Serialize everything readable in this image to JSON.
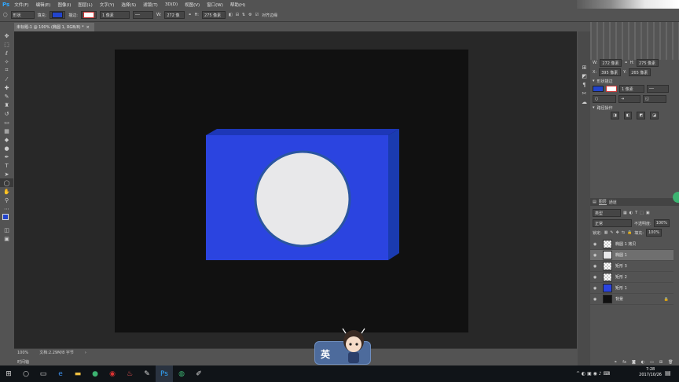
{
  "app": {
    "logo": "Ps"
  },
  "menu": [
    "文件(F)",
    "编辑(E)",
    "图像(I)",
    "图层(L)",
    "文字(Y)",
    "选择(S)",
    "滤镜(T)",
    "3D(D)",
    "视图(V)",
    "窗口(W)",
    "帮助(H)"
  ],
  "options": {
    "mode": "形状",
    "fill_label": "填充:",
    "stroke_label": "描边:",
    "stroke_width": "1 像素",
    "w_label": "W:",
    "w_value": "272 像",
    "h_label": "H:",
    "h_value": "275 像素",
    "align_edges": "对齐边缘",
    "fill_color": "#2244cc",
    "stroke_color": "#ffffff"
  },
  "document": {
    "tab_title": "未标题-1 @ 100% (椭圆 1, RGB/8) *",
    "zoom": "100%",
    "doc_info": "文档:2.29M/8 字节",
    "timeline": "时间轴"
  },
  "properties": {
    "w_value": "272 像素",
    "h_value": "275 像素",
    "x_value": "395 像素",
    "y_value": "265 像素",
    "section_shape": "形状描边",
    "stroke_width": "1 像素",
    "section_path_ops": "路径操作"
  },
  "layers_panel": {
    "tabs": [
      "图层",
      "通道"
    ],
    "kind_filter": "类型",
    "blend_mode": "正常",
    "opacity_label": "不透明度:",
    "opacity_value": "100%",
    "lock_label": "锁定:",
    "fill_label": "填充:",
    "fill_value": "100%",
    "layers": [
      {
        "name": "椭圆 1 拷贝",
        "selected": false
      },
      {
        "name": "椭圆 1",
        "selected": true
      },
      {
        "name": "矩形 3",
        "selected": false
      },
      {
        "name": "矩形 2",
        "selected": false
      },
      {
        "name": "矩形 1",
        "selected": false
      },
      {
        "name": "背景",
        "selected": false
      }
    ]
  },
  "overlay": {
    "char": "英"
  },
  "taskbar": {
    "time": "7:28",
    "date": "2017/10/26"
  },
  "colors": {
    "box_front": "#2b44e0",
    "box_top": "#1d37b8",
    "box_side": "#1a3bb0",
    "circle_fill": "#e8e8ea",
    "circle_stroke": "#2a55a0",
    "canvas_bg": "#111111"
  }
}
